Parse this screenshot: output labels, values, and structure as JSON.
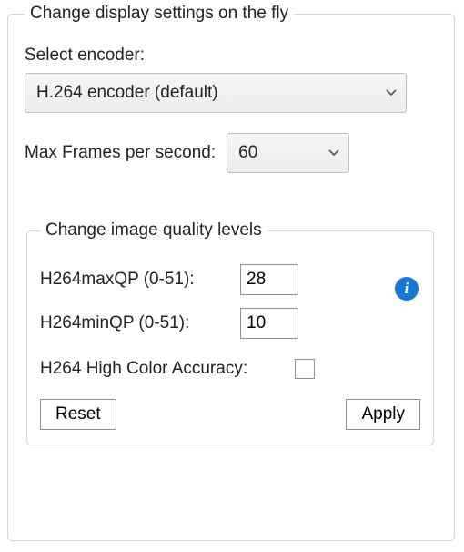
{
  "outer": {
    "legend": "Change display settings on the fly",
    "encoder_label": "Select encoder:",
    "encoder_value": "H.264 encoder (default)",
    "fps_label": "Max Frames per second:",
    "fps_value": "60"
  },
  "inner": {
    "legend": "Change image quality levels",
    "maxqp_label": "H264maxQP (0-51):",
    "maxqp_value": "28",
    "minqp_label": "H264minQP (0-51):",
    "minqp_value": "10",
    "hca_label": "H264 High Color Accuracy:",
    "hca_checked": false,
    "reset": "Reset",
    "apply": "Apply"
  },
  "icons": {
    "info_glyph": "i"
  }
}
